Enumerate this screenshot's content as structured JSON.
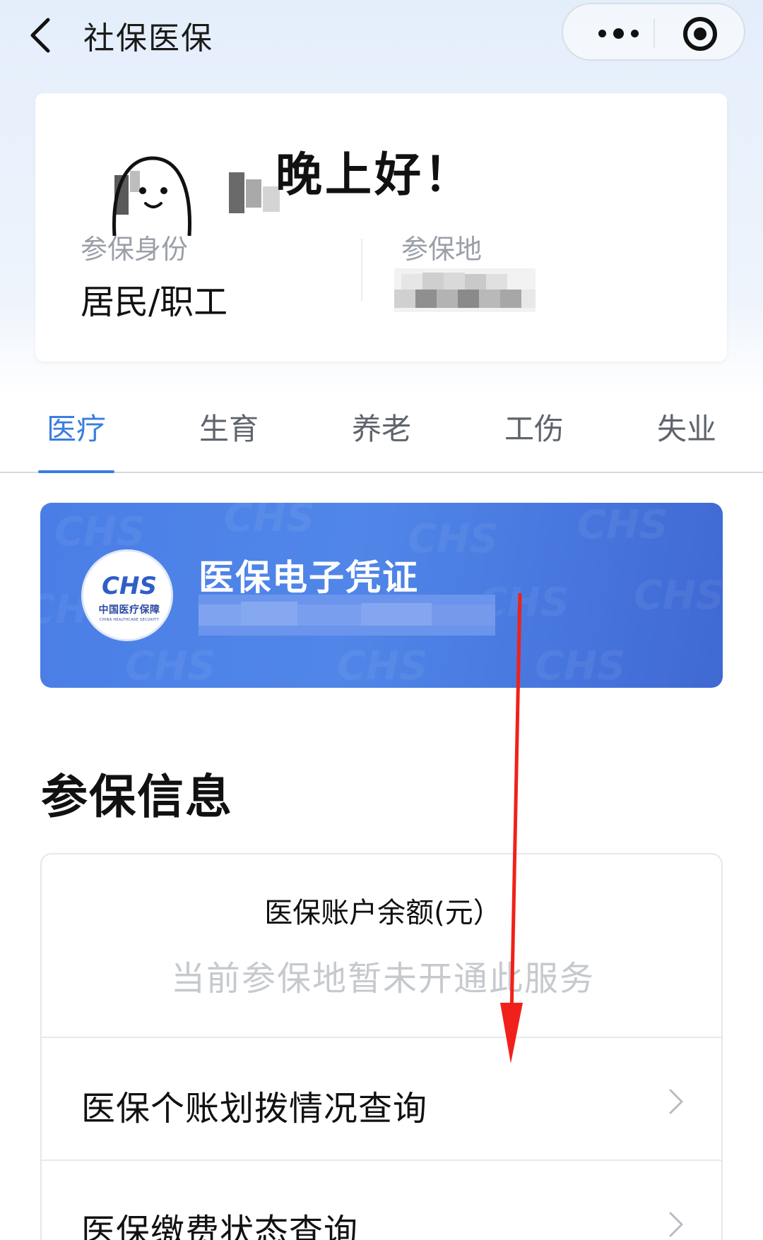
{
  "nav": {
    "title": "社保医保",
    "back_icon": "chevron-left-icon",
    "more_icon": "more-dots-icon",
    "capture_icon": "target-icon"
  },
  "user_card": {
    "greeting": "晚上好！",
    "identity_label": "参保身份",
    "identity_value": "居民/职工",
    "place_label": "参保地"
  },
  "tabs": [
    {
      "label": "医疗",
      "active": true
    },
    {
      "label": "生育",
      "active": false
    },
    {
      "label": "养老",
      "active": false
    },
    {
      "label": "工伤",
      "active": false
    },
    {
      "label": "失业",
      "active": false
    }
  ],
  "e_card": {
    "title": "医保电子凭证",
    "logo_mark": "CHS",
    "logo_cn": "中国医疗保障",
    "logo_en": "CHINA HEALTHCARE SECURITY"
  },
  "section": {
    "title": "参保信息"
  },
  "balance": {
    "title": "医保账户余额(元）",
    "note": "当前参保地暂未开通此服务"
  },
  "rows": [
    {
      "label": "医保个账划拨情况查询",
      "icon": "chevron-right-icon"
    },
    {
      "label": "医保缴费状态查询",
      "icon": "chevron-right-icon"
    }
  ],
  "colors": {
    "accent": "#3a7ee0",
    "card_blue": "#4a7ee6",
    "annotation_arrow": "#f0211a"
  }
}
